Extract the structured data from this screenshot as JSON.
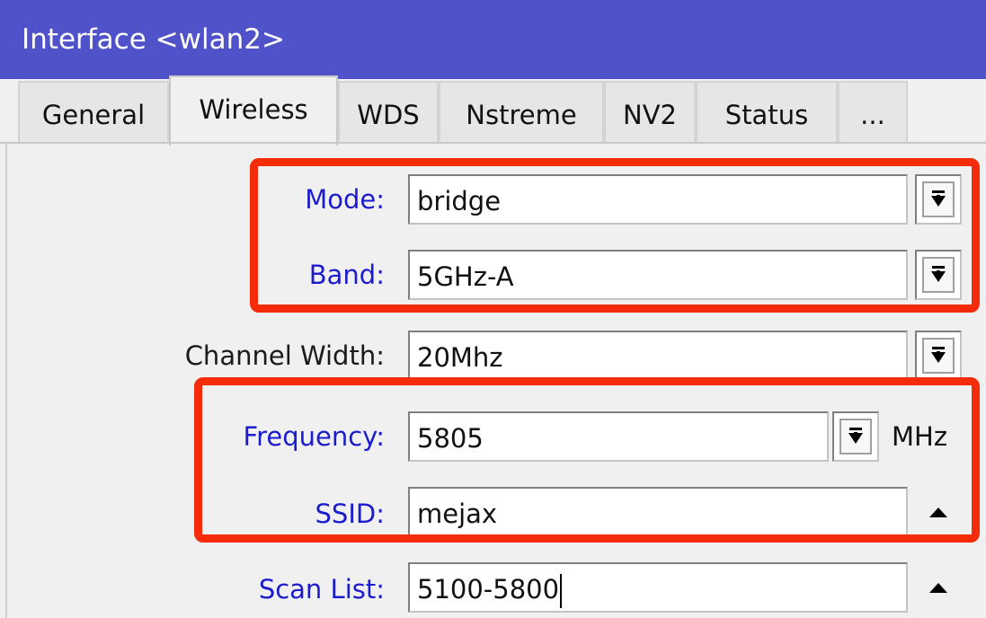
{
  "window": {
    "title": "Interface <wlan2>"
  },
  "tabs": [
    {
      "label": "General"
    },
    {
      "label": "Wireless"
    },
    {
      "label": "WDS"
    },
    {
      "label": "Nstreme"
    },
    {
      "label": "NV2"
    },
    {
      "label": "Status"
    },
    {
      "label": "..."
    }
  ],
  "active_tab": "Wireless",
  "fields": {
    "mode": {
      "label": "Mode:",
      "value": "bridge"
    },
    "band": {
      "label": "Band:",
      "value": "5GHz-A"
    },
    "channel_width": {
      "label": "Channel Width:",
      "value": "20Mhz"
    },
    "frequency": {
      "label": "Frequency:",
      "value": "5805",
      "unit": "MHz"
    },
    "ssid": {
      "label": "SSID:",
      "value": "mejax"
    },
    "scan_list": {
      "label": "Scan List:",
      "value": "5100-5800"
    }
  },
  "colors": {
    "titlebar": "#5052c9",
    "label_blue": "#1c1ccf",
    "highlight": "#f42c0a"
  }
}
